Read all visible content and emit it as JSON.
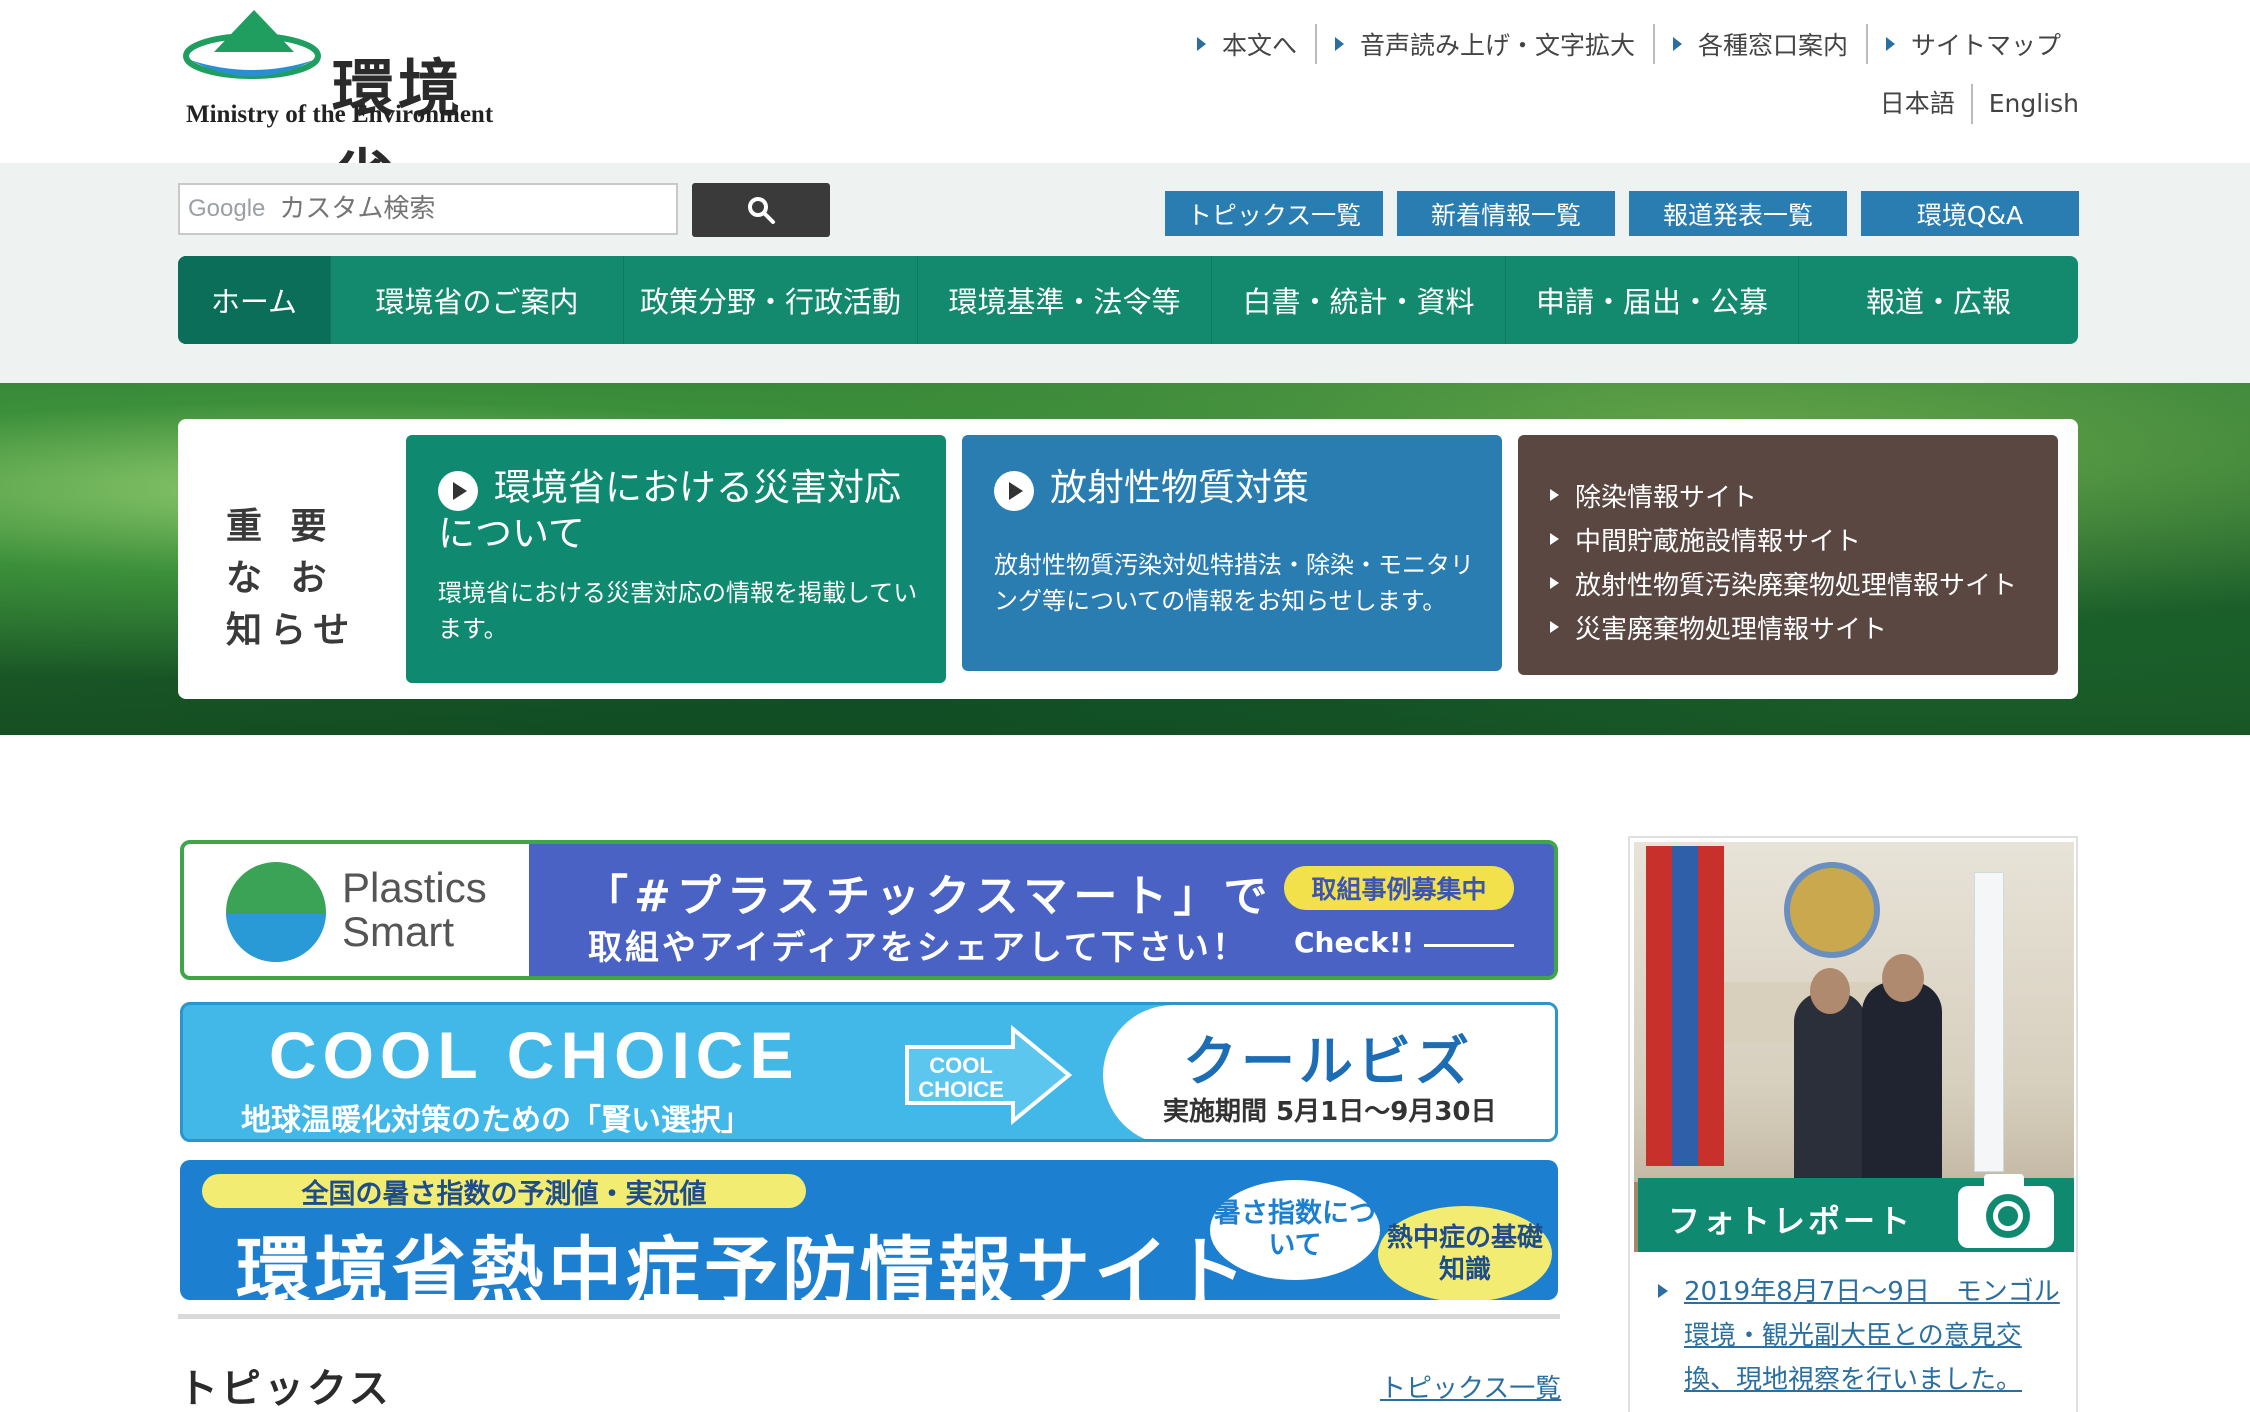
{
  "header": {
    "logo_title": "環境省",
    "logo_subtitle": "Ministry of the Environment",
    "utility_links": [
      "本文へ",
      "音声読み上げ・文字拡大",
      "各種窓口案内",
      "サイトマップ"
    ],
    "languages": [
      "日本語",
      "English"
    ]
  },
  "search": {
    "google_label": "Google",
    "placeholder": "カスタム検索"
  },
  "quick_links": [
    "トピックス一覧",
    "新着情報一覧",
    "報道発表一覧",
    "環境Q&A"
  ],
  "global_nav": [
    "ホーム",
    "環境省のご案内",
    "政策分野・行政活動",
    "環境基準・法令等",
    "白書・統計・資料",
    "申請・届出・公募",
    "報道・広報"
  ],
  "notice": {
    "label": "重 要 な お知らせ",
    "card1": {
      "title": "環境省における災害対応について",
      "desc": "環境省における災害対応の情報を掲載しています。"
    },
    "card2": {
      "title": "放射性物質対策",
      "desc": "放射性物質汚染対処特措法・除染・モニタリング等についての情報をお知らせします。"
    },
    "card3_links": [
      "除染情報サイト",
      "中間貯蔵施設情報サイト",
      "放射性物質汚染廃棄物処理情報サイト",
      "災害廃棄物処理情報サイト"
    ]
  },
  "banners": {
    "plastics": {
      "logo_text_1": "Plastics",
      "logo_text_2": "Smart",
      "line1": "「#プラスチックスマート」で",
      "line2": "取組やアイディアをシェアして下さい！",
      "badge": "取組事例募集中",
      "check": "Check!!"
    },
    "cool_choice": {
      "title": "COOL CHOICE",
      "subtitle": "地球温暖化対策のための「賢い選択」",
      "arrow_text_1": "COOL",
      "arrow_text_2": "CHOICE",
      "biz": "クールビズ",
      "period": "実施期間 5月1日～9月30日"
    },
    "heatstroke": {
      "pill": "全国の暑さ指数の予測値・実況値",
      "main": "環境省熱中症予防情報サイト",
      "bubble1": "暑さ指数について",
      "bubble2": "熱中症の基礎知識"
    }
  },
  "topics": {
    "heading": "トピックス",
    "list_link": "トピックス一覧"
  },
  "photo_report": {
    "caption": "フォトレポート",
    "link_text": "2019年8月7日～9日　モンゴル環境・観光副大臣との意見交換、現地視察を行いました。"
  },
  "colors": {
    "nav_green": "#138a6e",
    "home_green": "#0b6e58",
    "accent_blue": "#2a7db0",
    "brown": "#5a4742",
    "link_blue": "#2a6fa0"
  },
  "icons": {
    "search": "search-icon",
    "play": "play-icon",
    "camera": "camera-icon",
    "triangle": "triangle-right-icon"
  }
}
